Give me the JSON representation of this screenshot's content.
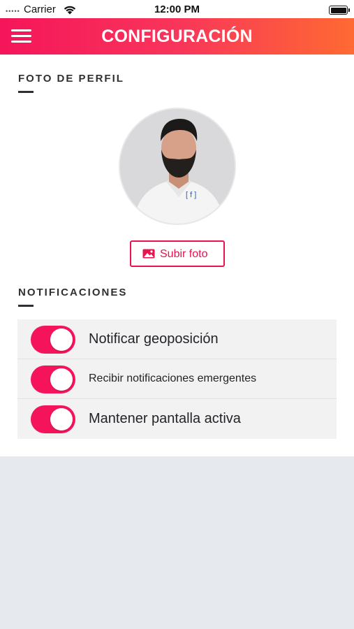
{
  "status_bar": {
    "signal_dots": "•••••",
    "carrier": "Carrier",
    "time": "12:00 PM"
  },
  "header": {
    "title": "CONFIGURACIÓN",
    "gradient_start": "#f5155a",
    "gradient_end": "#ff6a32"
  },
  "profile_section": {
    "title": "FOTO DE PERFIL",
    "upload_button_label": "Subir foto",
    "avatar_logo_text": "[ f ]"
  },
  "notifications_section": {
    "title": "NOTIFICACIONES",
    "items": [
      {
        "label": "Notificar geoposición",
        "enabled": true
      },
      {
        "label": "Recibir notificaciones emergentes",
        "enabled": true
      },
      {
        "label": "Mantener pantalla activa",
        "enabled": true
      }
    ]
  },
  "colors": {
    "accent": "#f5145b",
    "section_text": "#2f3033",
    "list_background": "#f2f2f3",
    "page_background": "#e6e9ee"
  }
}
